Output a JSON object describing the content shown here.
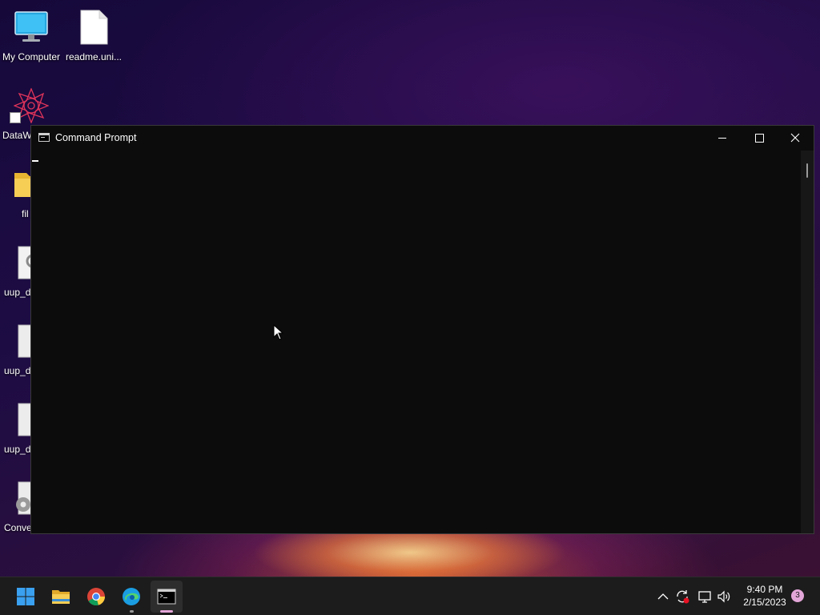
{
  "desktop": {
    "icons": [
      {
        "label": "My Computer",
        "icon": "computer-icon"
      },
      {
        "label": "readme.uni...",
        "icon": "file-icon"
      },
      {
        "label": "DataW",
        "icon": "datawrapper-app-icon"
      },
      {
        "label": "fil",
        "icon": "folder-icon"
      },
      {
        "label": "uup_d",
        "icon": "settings-file-icon"
      },
      {
        "label": "uup_d",
        "icon": "file-icon"
      },
      {
        "label": "uup_d",
        "icon": "file-icon"
      },
      {
        "label": "Conve",
        "icon": "gear-icon"
      }
    ]
  },
  "window": {
    "title": "Command Prompt",
    "icon": "command-prompt-icon",
    "background_color": "#0c0c0c",
    "controls": {
      "minimize": "minimize-icon",
      "maximize": "maximize-icon",
      "close": "close-icon"
    }
  },
  "taskbar": {
    "apps": [
      {
        "name": "Start",
        "icon": "windows-start-icon"
      },
      {
        "name": "File Explorer",
        "icon": "folder-icon"
      },
      {
        "name": "Google Chrome",
        "icon": "chrome-icon"
      },
      {
        "name": "Microsoft Edge",
        "icon": "edge-icon"
      },
      {
        "name": "Command Prompt",
        "icon": "command-prompt-icon",
        "active": true
      }
    ],
    "tray": {
      "icons": [
        "chevron-up-icon",
        "sync-icon",
        "network-icon",
        "volume-icon"
      ],
      "time": "9:40 PM",
      "date": "2/15/2023",
      "notifications": "3"
    },
    "accent_color": "#e3a6d8"
  }
}
